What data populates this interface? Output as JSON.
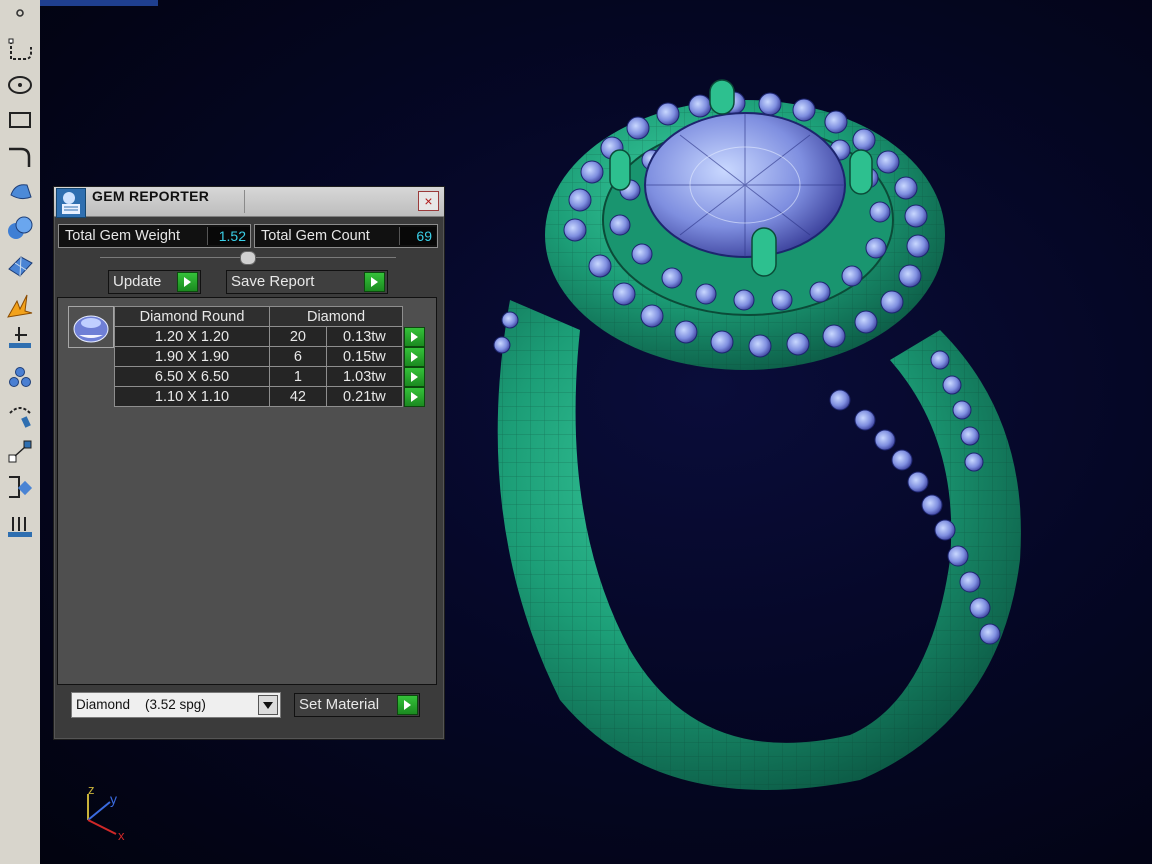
{
  "panel": {
    "title": "GEM REPORTER",
    "close_label": "×",
    "total_weight_label": "Total Gem Weight",
    "total_weight_value": "1.52",
    "total_count_label": "Total Gem Count",
    "total_count_value": "69",
    "update_label": "Update",
    "save_report_label": "Save Report",
    "table": {
      "header_shape": "Diamond Round",
      "header_material": "Diamond",
      "rows": [
        {
          "size": "1.20 X 1.20",
          "count": "20",
          "weight": "0.13tw"
        },
        {
          "size": "1.90 X 1.90",
          "count": "6",
          "weight": "0.15tw"
        },
        {
          "size": "6.50 X 6.50",
          "count": "1",
          "weight": "1.03tw"
        },
        {
          "size": "1.10 X 1.10",
          "count": "42",
          "weight": "0.21tw"
        }
      ]
    },
    "material_selected": "Diamond    (3.52 spg)",
    "set_material_label": "Set Material"
  },
  "axis": {
    "z": "z",
    "y": "y",
    "x": "x"
  },
  "colors": {
    "metal": "#1fa27a",
    "gem": "#7f8fe0",
    "background": "#050726",
    "accent_value": "#3ad0e8",
    "go_button": "#2aa72f"
  },
  "toolbar_icons": [
    "point-icon",
    "curve-icon",
    "circle-icon",
    "rectangle-icon",
    "fillet-icon",
    "surface-icon",
    "solid-icon",
    "mesh-icon",
    "render-icon",
    "dimension-icon",
    "gems-icon",
    "rotate-icon",
    "scale-icon",
    "transform-icon",
    "array-icon"
  ]
}
